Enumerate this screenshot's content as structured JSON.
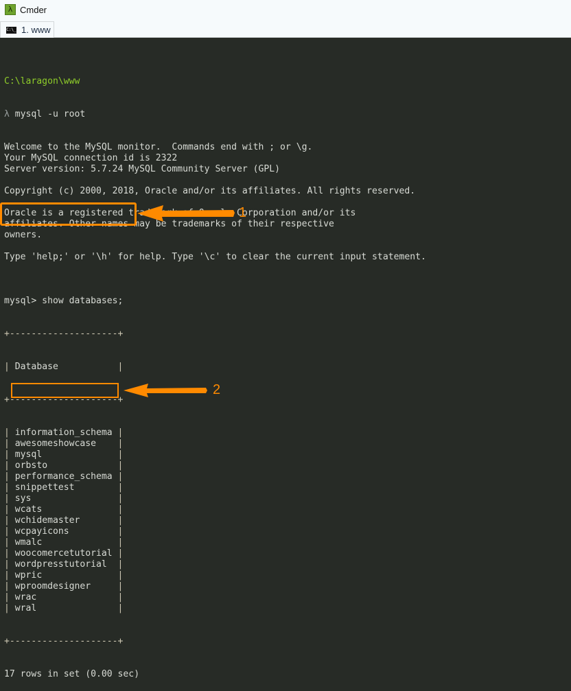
{
  "window": {
    "app_title": "Cmder",
    "app_icon": "lambda-icon",
    "tab_icon": "console-icon",
    "tab_label": "1. www"
  },
  "terminal": {
    "cwd": "C:\\laragon\\www",
    "prompt_symbol": "λ",
    "command": " mysql -u root",
    "welcome_lines": [
      "Welcome to the MySQL monitor.  Commands end with ; or \\g.",
      "Your MySQL connection id is 2322",
      "Server version: 5.7.24 MySQL Community Server (GPL)",
      "",
      "Copyright (c) 2000, 2018, Oracle and/or its affiliates. All rights reserved.",
      "",
      "Oracle is a registered trademark of Oracle Corporation and/or its",
      "affiliates. Other names may be trademarks of their respective",
      "owners.",
      "",
      "Type 'help;' or '\\h' for help. Type '\\c' to clear the current input statement.",
      ""
    ],
    "mysql_command": "mysql> show databases;",
    "table_border": "+--------------------+",
    "table_header": "| Database           |",
    "databases": [
      "information_schema",
      "awesomeshowcase",
      "mysql",
      "orbsto",
      "performance_schema",
      "snippettest",
      "sys",
      "wcats",
      "wchidemaster",
      "wcpayicons",
      "wmalc",
      "woocomercetutorial",
      "wordpresstutorial",
      "wpric",
      "wproomdesigner",
      "wrac",
      "wral"
    ],
    "result_summary": "17 rows in set (0.00 sec)"
  },
  "annotations": {
    "color": "#ff8a00",
    "step1_label": "1",
    "step2_label": "2"
  }
}
